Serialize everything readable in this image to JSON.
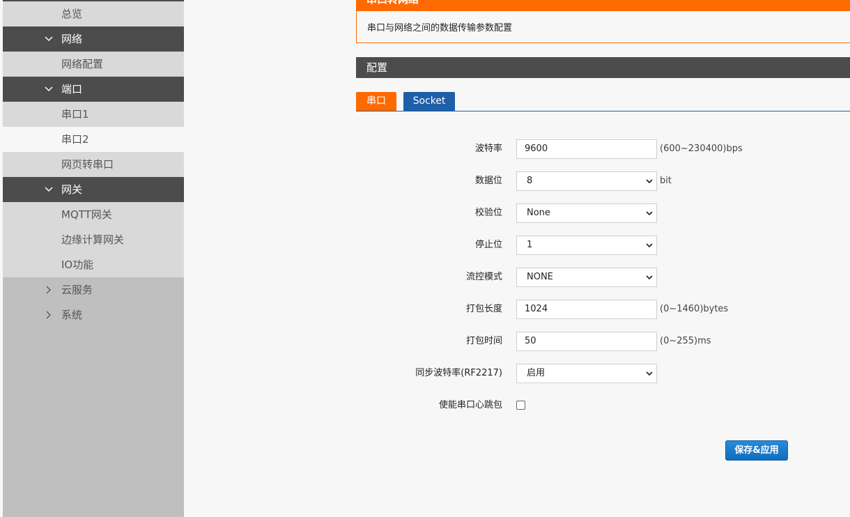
{
  "sidebar": {
    "items": [
      {
        "label": "总览",
        "type": "sub"
      },
      {
        "label": "网络",
        "type": "group"
      },
      {
        "label": "网络配置",
        "type": "sub"
      },
      {
        "label": "端口",
        "type": "group"
      },
      {
        "label": "串口1",
        "type": "sub"
      },
      {
        "label": "串口2",
        "type": "sub-active"
      },
      {
        "label": "网页转串口",
        "type": "sub"
      },
      {
        "label": "网关",
        "type": "group"
      },
      {
        "label": "MQTT网关",
        "type": "sub"
      },
      {
        "label": "边缘计算网关",
        "type": "sub"
      },
      {
        "label": "IO功能",
        "type": "sub"
      },
      {
        "label": "云服务",
        "type": "collapsed"
      },
      {
        "label": "系统",
        "type": "collapsed"
      }
    ]
  },
  "section": {
    "title": "串口转网络",
    "description": "串口与网络之间的数据传输参数配置"
  },
  "config": {
    "title": "配置"
  },
  "tabs": [
    {
      "label": "串口",
      "active": true
    },
    {
      "label": "Socket",
      "active": false
    }
  ],
  "form": {
    "baud": {
      "label": "波特率",
      "value": "9600",
      "hint": "(600~230400)bps"
    },
    "databits": {
      "label": "数据位",
      "value": "8",
      "hint": "bit"
    },
    "parity": {
      "label": "校验位",
      "value": "None"
    },
    "stopbits": {
      "label": "停止位",
      "value": "1"
    },
    "flow": {
      "label": "流控模式",
      "value": "NONE"
    },
    "packlen": {
      "label": "打包长度",
      "value": "1024",
      "hint": "(0~1460)bytes"
    },
    "packtime": {
      "label": "打包时间",
      "value": "50",
      "hint": "(0~255)ms"
    },
    "rfc2217": {
      "label": "同步波特率(RF2217)",
      "value": "启用"
    },
    "heartbeat": {
      "label": "使能串口心跳包",
      "checked": false
    }
  },
  "save_label": "保存&应用",
  "colors": {
    "accent": "#ff6a00",
    "dark": "#4c4c4c",
    "blue": "#1e5fa8"
  }
}
